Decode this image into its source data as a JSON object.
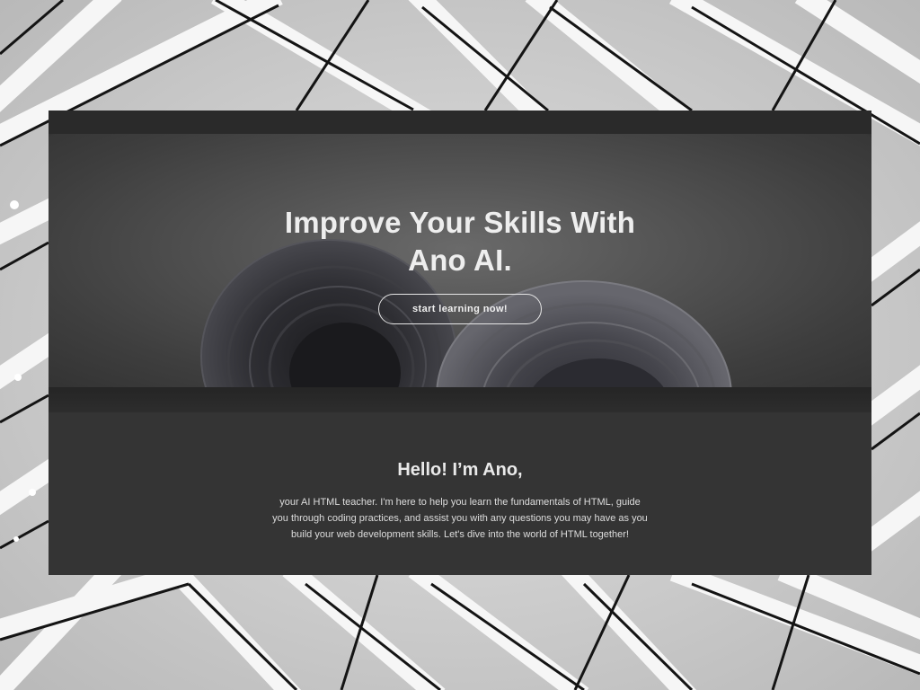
{
  "hero": {
    "title_line1": "Improve Your Skills With",
    "title_line2": "Ano AI.",
    "cta_label": "start learning now!"
  },
  "about": {
    "heading": "Hello! I’m Ano,",
    "body_line1": "your AI HTML teacher. I'm here to help you learn the fundamentals of HTML, guide",
    "body_line2": "you through coding practices, and assist you with any questions you may have as you",
    "body_line3": "build your web development skills. Let's dive into the world of HTML together!"
  },
  "colors": {
    "backdrop": "#d2d2d2",
    "card_background": "#343434",
    "text_light": "#eeeeee"
  }
}
